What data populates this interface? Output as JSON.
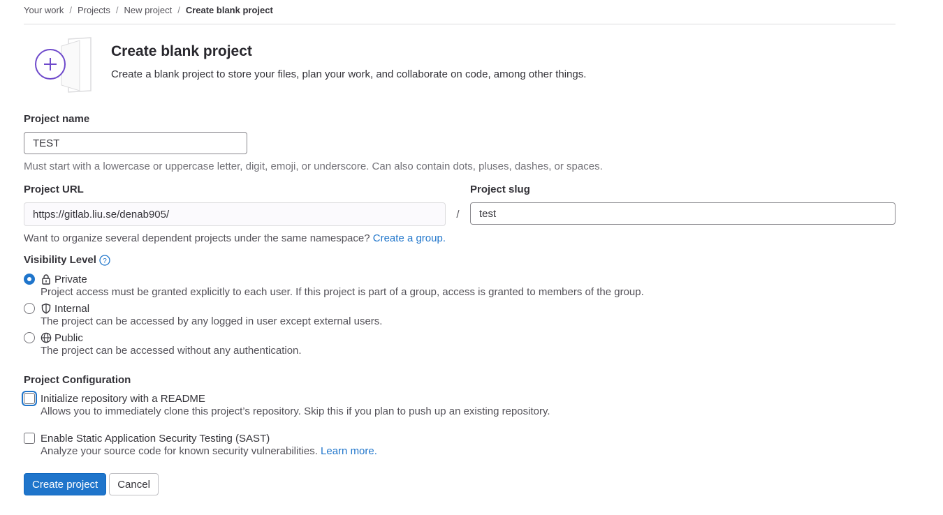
{
  "breadcrumb": [
    "Your work",
    "Projects",
    "New project",
    "Create blank project"
  ],
  "header": {
    "title": "Create blank project",
    "subtitle": "Create a blank project to store your files, plan your work, and collaborate on code, among other things."
  },
  "project_name": {
    "label": "Project name",
    "value": "TEST",
    "help": "Must start with a lowercase or uppercase letter, digit, emoji, or underscore. Can also contain dots, pluses, dashes, or spaces."
  },
  "project_url": {
    "label": "Project URL",
    "value": "https://gitlab.liu.se/denab905/",
    "separator": "/",
    "help_text": "Want to organize several dependent projects under the same namespace?",
    "help_link": "Create a group."
  },
  "project_slug": {
    "label": "Project slug",
    "value": "test"
  },
  "visibility": {
    "label": "Visibility Level",
    "options": [
      {
        "label": "Private",
        "icon": "lock-icon",
        "checked": true,
        "desc": "Project access must be granted explicitly to each user. If this project is part of a group, access is granted to members of the group."
      },
      {
        "label": "Internal",
        "icon": "shield-icon",
        "checked": false,
        "desc": "The project can be accessed by any logged in user except external users."
      },
      {
        "label": "Public",
        "icon": "globe-icon",
        "checked": false,
        "desc": "The project can be accessed without any authentication."
      }
    ]
  },
  "config": {
    "label": "Project Configuration",
    "readme": {
      "label": "Initialize repository with a README",
      "desc": "Allows you to immediately clone this project’s repository. Skip this if you plan to push up an existing repository.",
      "checked": false
    },
    "sast": {
      "label": "Enable Static Application Security Testing (SAST)",
      "desc": "Analyze your source code for known security vulnerabilities.",
      "link": "Learn more.",
      "checked": false
    }
  },
  "actions": {
    "create": "Create project",
    "cancel": "Cancel"
  },
  "colors": {
    "primary": "#1f75cb",
    "illustration_accent": "#6e49cb"
  }
}
